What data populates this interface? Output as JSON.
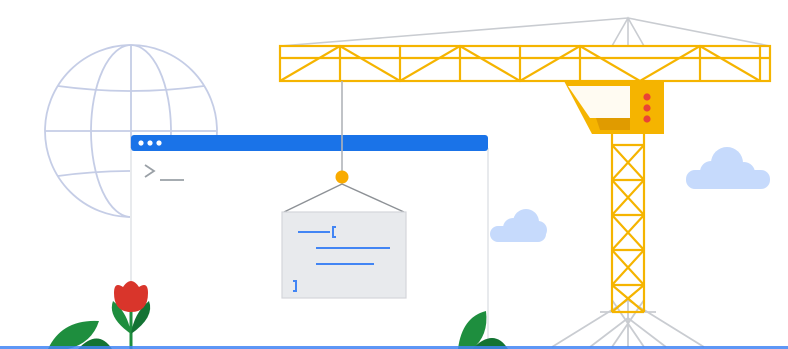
{
  "colors": {
    "crane": "#f5b400",
    "crane_dark": "#e09b00",
    "crane_outline": "#e8a800",
    "lattice_gray": "#c9ccd1",
    "globe_blue": "#c5cde6",
    "browser_bar": "#1a73e8",
    "browser_border": "#e8eaed",
    "code_card": "#e8eaed",
    "code_line": "#4285f4",
    "cloud": "#c6dafc",
    "cab_dots": "#ea4335",
    "flower_red": "#d9352b",
    "leaf_green": "#1e8e3e",
    "leaf_dark": "#137333",
    "ground_blue": "#4285f4",
    "hook": "#f9ab00",
    "prompt_gray": "#9aa0a6"
  },
  "icons": [
    "globe-icon",
    "tower-crane",
    "browser-window",
    "terminal-prompt-icon",
    "code-card",
    "cloud-icon",
    "flower-icon",
    "leaf-icon"
  ]
}
